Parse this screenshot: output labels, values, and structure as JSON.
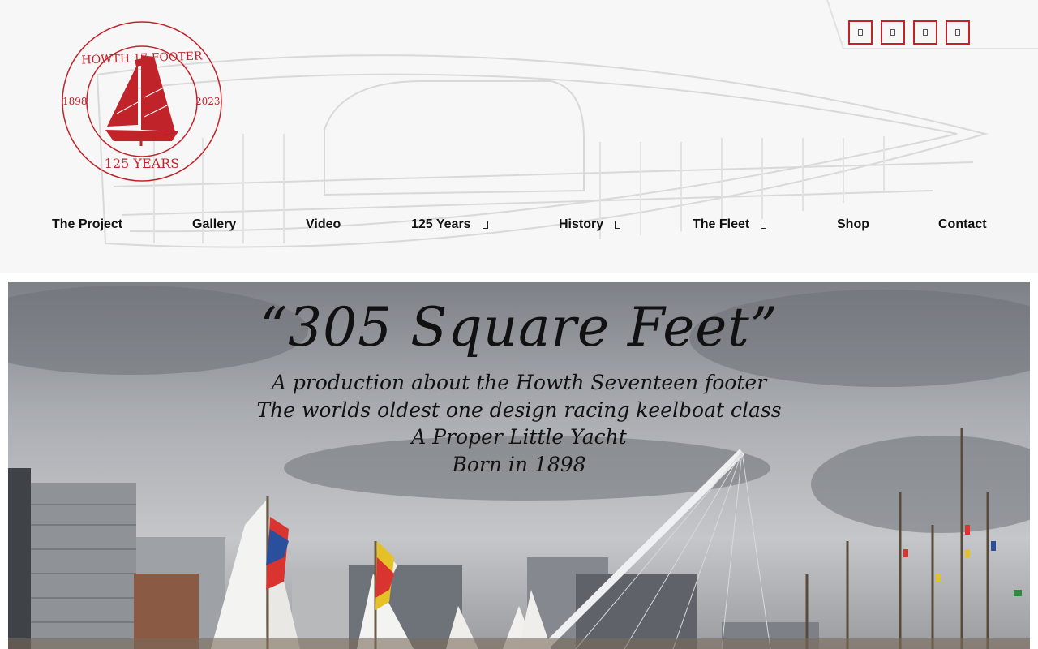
{
  "logo": {
    "top_text": "HOWTH 17 FOOTER",
    "year_left": "1898",
    "year_right": "2023",
    "bottom_text": "125 YEARS",
    "color": "#c0242a"
  },
  "social": [
    {
      "icon": "facebook-icon"
    },
    {
      "icon": "instagram-icon"
    },
    {
      "icon": "youtube-icon"
    },
    {
      "icon": "twitter-icon"
    }
  ],
  "nav": {
    "items": [
      {
        "label": "The Project"
      },
      {
        "label": "Gallery"
      },
      {
        "label": "Video"
      },
      {
        "label": "125 Years"
      },
      {
        "label": "History"
      },
      {
        "label": "The Fleet"
      },
      {
        "label": "Shop"
      },
      {
        "label": "Contact"
      }
    ]
  },
  "hero": {
    "title": "“305 Square Feet”",
    "lines": [
      "A production about the Howth Seventeen footer",
      "The worlds oldest one design racing keelboat class",
      "A Proper Little Yacht",
      "Born in 1898"
    ]
  },
  "colors": {
    "accent": "#c0242a",
    "header_bg": "#f7f7f7",
    "nav_text": "#111111"
  }
}
